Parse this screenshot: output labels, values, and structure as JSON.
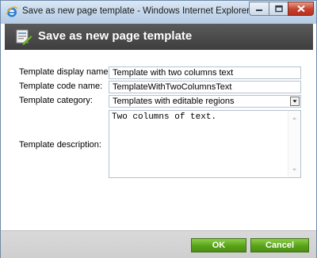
{
  "window": {
    "title": "Save as new page template - Windows Internet Explorer"
  },
  "header": {
    "title": "Save as new page template"
  },
  "form": {
    "display_name_label": "Template display name:",
    "display_name_value": "Template with two columns text",
    "code_name_label": "Template code name:",
    "code_name_value": "TemplateWithTwoColumnsText",
    "category_label": "Template category:",
    "category_value": "Templates with editable regions",
    "description_label": "Template description:",
    "description_value": "Two columns of text."
  },
  "buttons": {
    "ok_label": "OK",
    "cancel_label": "Cancel"
  },
  "colors": {
    "header_bg": "#4a4a4a",
    "button_green": "#5aa21b",
    "footer_bg": "#d4d4d4"
  },
  "icons": {
    "browser": "internet-explorer-icon",
    "header": "page-template-icon"
  }
}
